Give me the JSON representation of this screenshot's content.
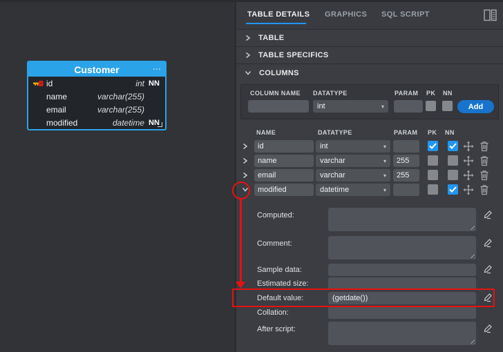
{
  "colors": {
    "accent_blue": "#2196f3",
    "table_header_blue": "#2ba3e8",
    "annotation_red": "#ea1010",
    "add_button_blue": "#1873cc"
  },
  "icons": {
    "ellipsis": "⋯",
    "select_arrow": "▾"
  },
  "canvas": {
    "table": {
      "title": "Customer",
      "columns": [
        {
          "name": "id",
          "type": "int",
          "nn": "NN"
        },
        {
          "name": "name",
          "type": "varchar(255)",
          "nn": ""
        },
        {
          "name": "email",
          "type": "varchar(255)",
          "nn": ""
        },
        {
          "name": "modified",
          "type": "datetime",
          "nn": "NN"
        }
      ]
    }
  },
  "panel": {
    "tabs": [
      {
        "label": "TABLE DETAILS",
        "active": true
      },
      {
        "label": "GRAPHICS",
        "active": false
      },
      {
        "label": "SQL SCRIPT",
        "active": false
      }
    ],
    "sections": [
      {
        "label": "TABLE",
        "expanded": false
      },
      {
        "label": "TABLE SPECIFICS",
        "expanded": false
      },
      {
        "label": "COLUMNS",
        "expanded": true
      }
    ],
    "add_form": {
      "headers": {
        "column_name": "COLUMN NAME",
        "datatype": "DATATYPE",
        "param": "PARAM",
        "pk": "PK",
        "nn": "NN"
      },
      "column_name_value": "",
      "datatype_value": "int",
      "param_value": "",
      "pk_checked": false,
      "nn_checked": false,
      "add_label": "Add"
    },
    "columns": {
      "headers": {
        "name": "NAME",
        "datatype": "DATATYPE",
        "param": "PARAM",
        "pk": "PK",
        "nn": "NN"
      },
      "rows": [
        {
          "name": "id",
          "datatype": "int",
          "param": "",
          "pk": true,
          "nn": true,
          "expanded": false
        },
        {
          "name": "name",
          "datatype": "varchar",
          "param": "255",
          "pk": false,
          "nn": false,
          "expanded": false
        },
        {
          "name": "email",
          "datatype": "varchar",
          "param": "255",
          "pk": false,
          "nn": false,
          "expanded": false
        },
        {
          "name": "modified",
          "datatype": "datetime",
          "param": "",
          "pk": false,
          "nn": true,
          "expanded": true
        }
      ]
    },
    "detail": {
      "fields": [
        {
          "label": "Computed:",
          "value": ""
        },
        {
          "label": "Comment:",
          "value": ""
        },
        {
          "label": "Sample data:",
          "value": ""
        },
        {
          "label": "Estimated size:",
          "value": ""
        },
        {
          "label": "Default value:",
          "value": "(getdate())"
        },
        {
          "label": "Collation:",
          "value": ""
        },
        {
          "label": "After script:",
          "value": ""
        }
      ]
    }
  }
}
